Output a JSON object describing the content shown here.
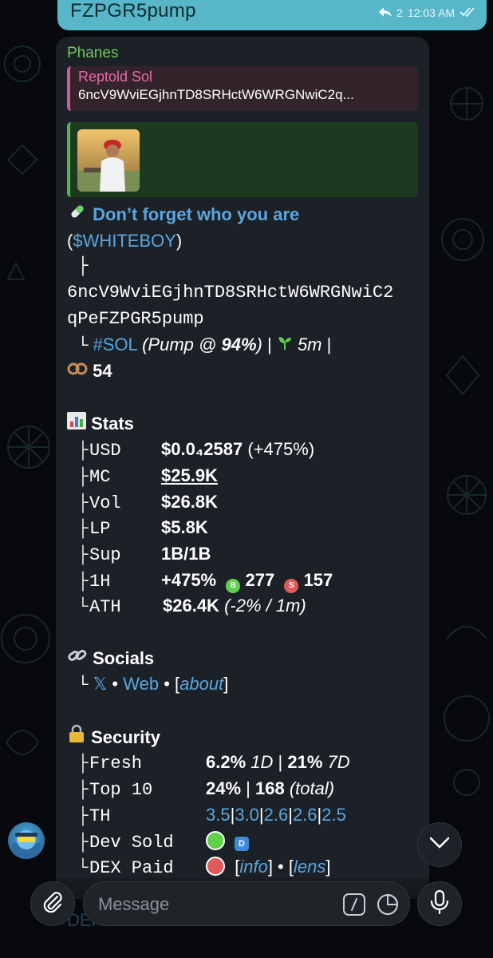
{
  "outgoing": {
    "text": "FZPGR5pump",
    "reply_count": "2",
    "time": "12:03 AM"
  },
  "message": {
    "sender": "Phanes",
    "reply": {
      "name": "Reptold Sol",
      "text": "6ncV9WviEGjhnTD8SRHctW6WRGNwiC2q..."
    },
    "title": "Don’t forget who you are",
    "ticker": "$WHITEBOY",
    "address_line1": "6ncV9WviEGjhnTD8SRHctW6WRGNwiC2",
    "address_line2": "qPeFZPGR5pump",
    "chain_tag": "#SOL",
    "pump_prefix": "(Pump @ ",
    "pump_pct": "94%",
    "pump_suffix": ")",
    "sep": "|",
    "age": "5m",
    "holders_count": "54",
    "stats": {
      "heading": "Stats",
      "usd_label": "USD",
      "usd_value": "$0.0₄2587",
      "usd_change": "(+475%)",
      "mc_label": "MC",
      "mc_value": "$25.9K",
      "vol_label": "Vol",
      "vol_value": "$26.8K",
      "lp_label": "LP",
      "lp_value": "$5.8K",
      "sup_label": "Sup",
      "sup_value": "1B/1B",
      "h1_label": "1H",
      "h1_value": "+475%",
      "buys_badge": "B",
      "buys": "277",
      "sells_badge": "S",
      "sells": "157",
      "ath_label": "ATH",
      "ath_value": "$26.4K",
      "ath_detail": "(-2% / 1m)"
    },
    "socials": {
      "heading": "Socials",
      "x_label": "𝕏",
      "dot": "•",
      "web_label": "Web",
      "bracket_open": "[",
      "about_label": "about",
      "bracket_close": "]"
    },
    "security": {
      "heading": "Security",
      "fresh_label": "Fresh",
      "fresh_1d": "6.2%",
      "fresh_1d_unit": "1D",
      "fresh_7d": "21%",
      "fresh_7d_unit": "7D",
      "top10_label": "Top 10",
      "top10_value": "24%",
      "top10_total": "168",
      "top10_total_label": "(total)",
      "th_label": "TH",
      "th_values": [
        "3.5",
        "3.0",
        "2.6",
        "2.6",
        "2.5"
      ],
      "dev_label": "Dev Sold",
      "dev_badge": "D",
      "dex_label": "DEX Paid",
      "info_label": "info",
      "lens_label": "lens"
    }
  },
  "composer": {
    "placeholder": "Message",
    "under_text": "DEF"
  },
  "colors": {
    "accent_link": "#5aa6e0",
    "outgoing_bubble": "#57b6c7",
    "sender": "#6fc857",
    "reply_accent": "#d8579a",
    "green_dot": "#5fd04b",
    "red_dot": "#e05a5a"
  }
}
